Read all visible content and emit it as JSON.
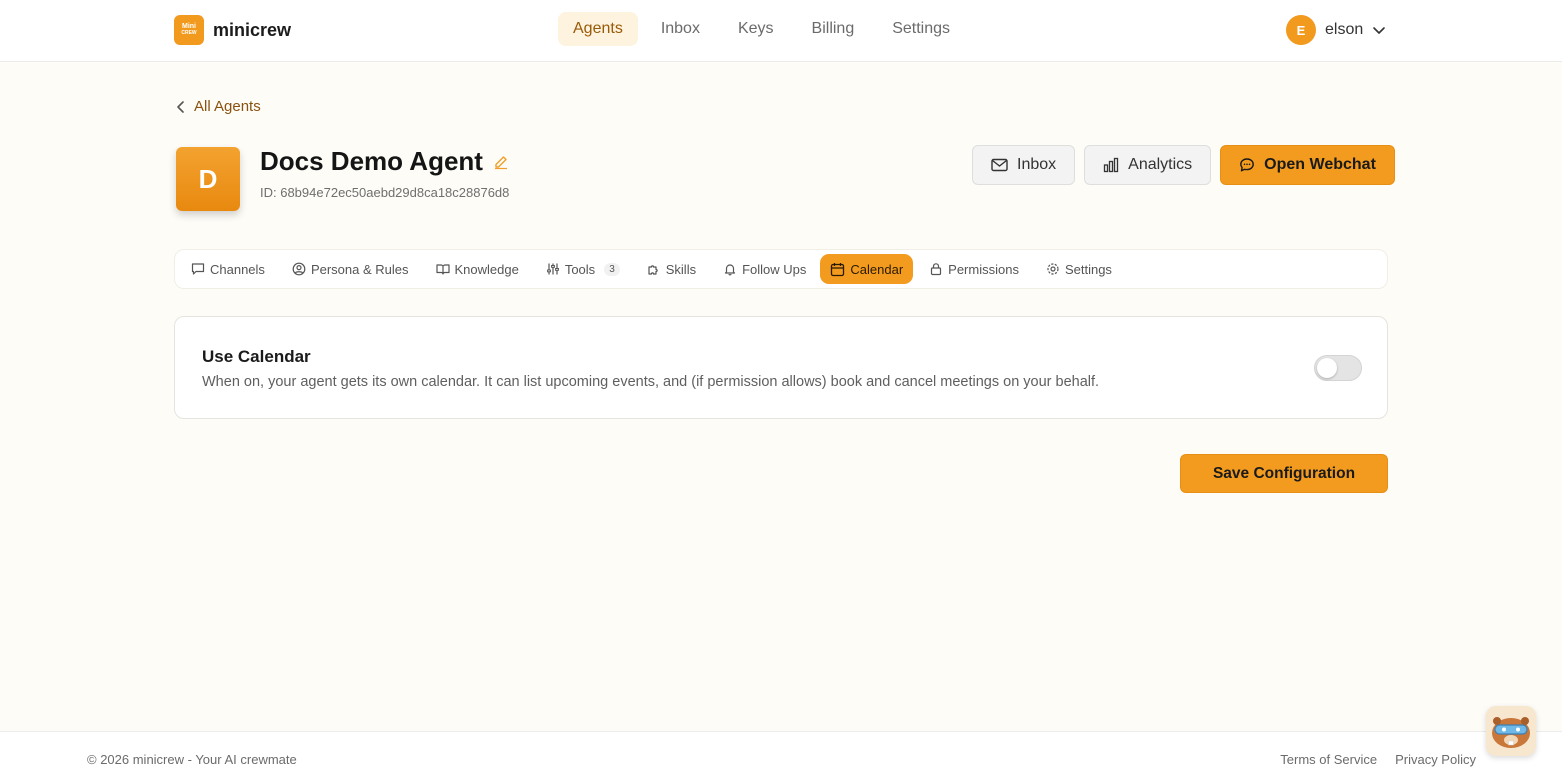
{
  "brand": {
    "logo_line1": "Mini",
    "logo_line2": "CREW",
    "name": "minicrew",
    "accent": "#f39b1f"
  },
  "nav": {
    "items": [
      "Agents",
      "Inbox",
      "Keys",
      "Billing",
      "Settings"
    ],
    "active": "Agents"
  },
  "user": {
    "initial": "E",
    "name": "elson"
  },
  "back_link": "All Agents",
  "agent": {
    "avatar_letter": "D",
    "name": "Docs Demo Agent",
    "id_text": "ID: 68b94e72ec50aebd29d8ca18c28876d8"
  },
  "actions": {
    "inbox": "Inbox",
    "analytics": "Analytics",
    "webchat": "Open Webchat"
  },
  "tabs": {
    "channels": "Channels",
    "persona": "Persona & Rules",
    "knowledge": "Knowledge",
    "tools": "Tools",
    "tools_count": "3",
    "skills": "Skills",
    "followups": "Follow Ups",
    "calendar": "Calendar",
    "permissions": "Permissions",
    "settings": "Settings",
    "active": "Calendar"
  },
  "calendar_card": {
    "title": "Use Calendar",
    "description": "When on, your agent gets its own calendar. It can list upcoming events, and (if permission allows) book and cancel meetings on your behalf.",
    "enabled": false
  },
  "save_label": "Save Configuration",
  "footer": {
    "copyright": "© 2026 minicrew - Your AI crewmate",
    "terms": "Terms of Service",
    "privacy": "Privacy Policy"
  }
}
